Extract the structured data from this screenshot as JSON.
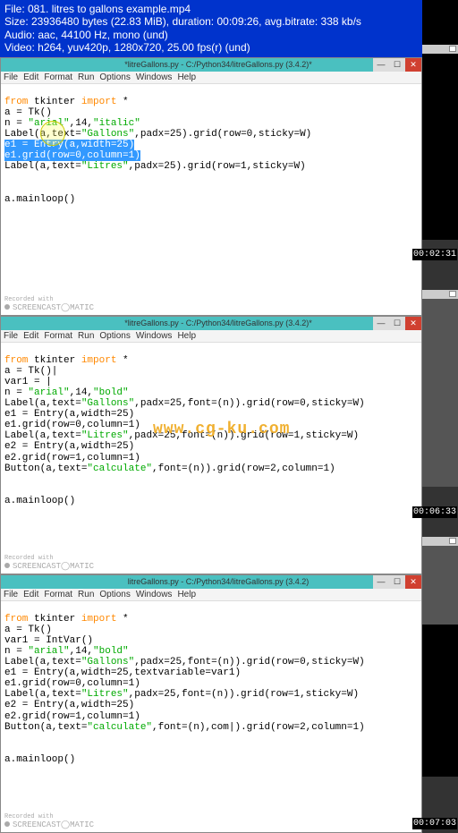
{
  "banner": {
    "line1": "File: 081. litres to gallons example.mp4",
    "line2": "Size: 23936480 bytes (22.83 MiB), duration: 00:09:26, avg.bitrate: 338 kb/s",
    "line3": "Audio: aac, 44100 Hz, mono (und)",
    "line4": "Video: h264, yuv420p, 1280x720, 25.00 fps(r) (und)"
  },
  "menu": {
    "file": "File",
    "edit": "Edit",
    "format": "Format",
    "run": "Run",
    "options": "Options",
    "windows": "Windows",
    "help": "Help"
  },
  "window1": {
    "title": "*litreGallons.py - C:/Python34/litreGallons.py (3.4.2)*",
    "code_l1_a": "from",
    "code_l1_b": " tkinter ",
    "code_l1_c": "import",
    "code_l1_d": " *",
    "code_l2": "a = Tk()",
    "code_l3_a": "n = ",
    "code_l3_b": "\"arial\"",
    "code_l3_c": ",14,",
    "code_l3_d": "\"italic\"",
    "code_l4_a": "Label(a,text=",
    "code_l4_b": "\"Gallons\"",
    "code_l4_c": ",padx=25).grid(row=0,sticky=W)",
    "code_l5": "e1 = Entry(a,width=25)",
    "code_l6": "e1.grid(row=0,column=1)",
    "code_l7_a": "Label(a,text=",
    "code_l7_b": "\"Litres\"",
    "code_l7_c": ",padx=25).grid(row=1,sticky=W)",
    "code_l8": "a.mainloop()"
  },
  "window2": {
    "title": "*litreGallons.py - C:/Python34/litreGallons.py (3.4.2)*",
    "code_l1_a": "from",
    "code_l1_b": " tkinter ",
    "code_l1_c": "import",
    "code_l1_d": " *",
    "code_l2": "a = Tk()|",
    "code_l3": "var1 = |",
    "code_l4_a": "n = ",
    "code_l4_b": "\"arial\"",
    "code_l4_c": ",14,",
    "code_l4_d": "\"bold\"",
    "code_l5_a": "Label(a,text=",
    "code_l5_b": "\"Gallons\"",
    "code_l5_c": ",padx=25,font=(n)).grid(row=0,sticky=W)",
    "code_l6": "e1 = Entry(a,width=25)",
    "code_l7": "e1.grid(row=0,column=1)",
    "code_l8_a": "Label(a,text=",
    "code_l8_b": "\"Litres\"",
    "code_l8_c": ",padx=25,font=(n)).grid(row=1,sticky=W)",
    "code_l9": "e2 = Entry(a,width=25)",
    "code_l10": "e2.grid(row=1,column=1)",
    "code_l11_a": "Button(a,text=",
    "code_l11_b": "\"calculate\"",
    "code_l11_c": ",font=(n)).grid(row=2,column=1)",
    "code_l12": "a.mainloop()"
  },
  "window3": {
    "title": "litreGallons.py - C:/Python34/litreGallons.py (3.4.2)",
    "code_l1_a": "from",
    "code_l1_b": " tkinter ",
    "code_l1_c": "import",
    "code_l1_d": " *",
    "code_l2": "a = Tk()",
    "code_l3": "var1 = IntVar()",
    "code_l4_a": "n = ",
    "code_l4_b": "\"arial\"",
    "code_l4_c": ",14,",
    "code_l4_d": "\"bold\"",
    "code_l5_a": "Label(a,text=",
    "code_l5_b": "\"Gallons\"",
    "code_l5_c": ",padx=25,font=(n)).grid(row=0,sticky=W)",
    "code_l6": "e1 = Entry(a,width=25,textvariable=var1)",
    "code_l7": "e1.grid(row=0,column=1)",
    "code_l8_a": "Label(a,text=",
    "code_l8_b": "\"Litres\"",
    "code_l8_c": ",padx=25,font=(n)).grid(row=1,sticky=W)",
    "code_l9": "e2 = Entry(a,width=25)",
    "code_l10": "e2.grid(row=1,column=1)",
    "code_l11_a": "Button(a,text=",
    "code_l11_b": "\"calculate\"",
    "code_l11_c": ",font=(n),com|).grid(row=2,column=1)",
    "code_l12": "a.mainloop()"
  },
  "watermark_label": "SCREENCAST◯MATIC",
  "watermark_small": "Recorded with",
  "cg_watermark": "www.cg-ku.com",
  "timestamps": {
    "t1": "00:02:31",
    "t2": "00:06:33",
    "t3": "00:07:03"
  }
}
